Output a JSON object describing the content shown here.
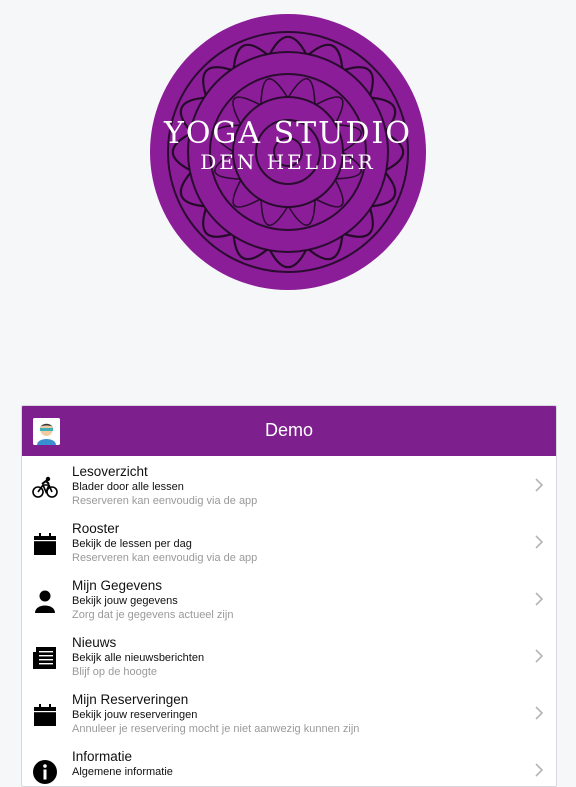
{
  "logo": {
    "line1": "YOGA STUDIO",
    "line2": "DEN HELDER",
    "color": "#8b1d98"
  },
  "header": {
    "title": "Demo",
    "color": "#7e1f8e"
  },
  "menu": [
    {
      "icon": "bicycle-icon",
      "title": "Lesoverzicht",
      "subtitle": "Blader door alle lessen",
      "hint": "Reserveren kan eenvoudig via de app"
    },
    {
      "icon": "calendar-icon",
      "title": "Rooster",
      "subtitle": "Bekijk de lessen per dag",
      "hint": "Reserveren kan eenvoudig via de app"
    },
    {
      "icon": "user-icon",
      "title": "Mijn Gegevens",
      "subtitle": "Bekijk jouw gegevens",
      "hint": "Zorg dat je gegevens actueel zijn"
    },
    {
      "icon": "newspaper-icon",
      "title": "Nieuws",
      "subtitle": "Bekijk alle nieuwsberichten",
      "hint": "Blijf op de hoogte"
    },
    {
      "icon": "calendar-icon",
      "title": "Mijn Reserveringen",
      "subtitle": "Bekijk jouw reserveringen",
      "hint": "Annuleer je reservering mocht je niet aanwezig kunnen zijn"
    },
    {
      "icon": "info-icon",
      "title": "Informatie",
      "subtitle": "Algemene informatie",
      "hint": ""
    }
  ]
}
